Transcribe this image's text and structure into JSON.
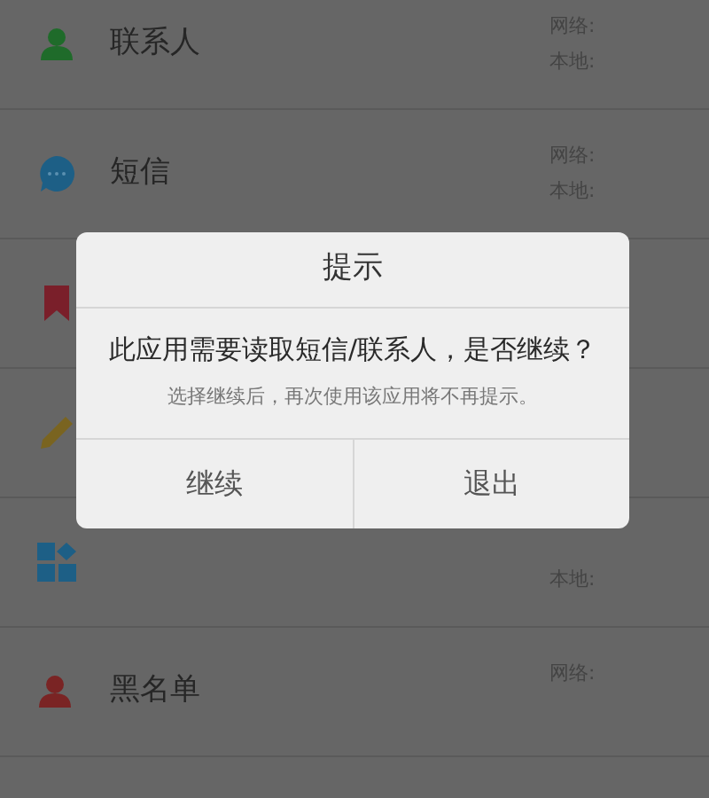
{
  "list": [
    {
      "kind": "contacts",
      "title": "联系人",
      "network": "网络:",
      "local": "本地:"
    },
    {
      "kind": "sms",
      "title": "短信",
      "network": "网络:",
      "local": "本地:"
    },
    {
      "kind": "bookmark"
    },
    {
      "kind": "edit"
    },
    {
      "kind": "apps",
      "local": "本地:"
    },
    {
      "kind": "blacklist",
      "title": "黑名单",
      "network": "网络:"
    }
  ],
  "dialog": {
    "title": "提示",
    "message": "此应用需要读取短信/联系人，是否继续？",
    "hint": "选择继续后，再次使用该应用将不再提示。",
    "buttons": [
      "继续",
      "退出"
    ]
  }
}
